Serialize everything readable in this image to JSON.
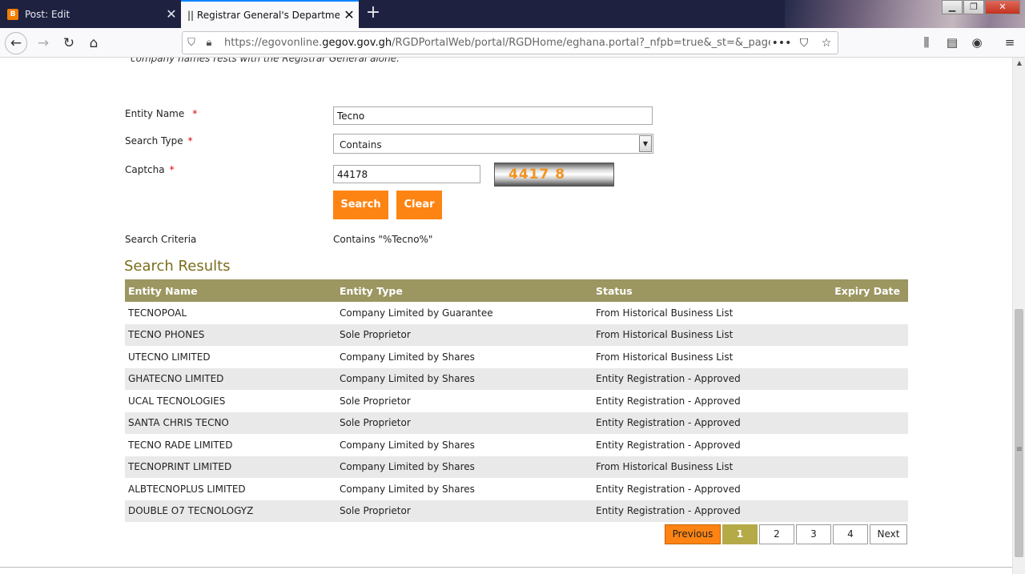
{
  "browser": {
    "tabs": [
      {
        "title": "Post: Edit",
        "favicon": "B"
      },
      {
        "title": "|| Registrar General's Department ||"
      }
    ],
    "url_prefix": "https://egovonline.",
    "url_domain": "gegov.gov.gh",
    "url_path": "/RGDPortalWeb/portal/RGDHome/eghana.portal?_nfpb=true&_st=&_pageLab"
  },
  "page": {
    "notice": "company names rests with the Registrar General alone.",
    "form": {
      "entity_name_label": "Entity Name",
      "entity_name_value": "Tecno",
      "search_type_label": "Search Type",
      "search_type_value": "Contains",
      "captcha_label": "Captcha",
      "captcha_value": "44178",
      "captcha_image_text": "4417 8",
      "required_mark": "*",
      "search_button": "Search",
      "clear_button": "Clear"
    },
    "criteria_label": "Search Criteria",
    "criteria_value": "Contains \"%Tecno%\"",
    "results_title": "Search Results",
    "results": {
      "columns": [
        "Entity Name",
        "Entity Type",
        "Status",
        "Expiry Date"
      ],
      "rows": [
        [
          "TECNOPOAL",
          "Company Limited by Guarantee",
          "From Historical Business List",
          ""
        ],
        [
          "TECNO PHONES",
          "Sole Proprietor",
          "From Historical Business List",
          ""
        ],
        [
          "UTECNO LIMITED",
          "Company Limited by Shares",
          "From Historical Business List",
          ""
        ],
        [
          "GHATECNO LIMITED",
          "Company Limited by Shares",
          "Entity Registration - Approved",
          ""
        ],
        [
          "UCAL TECNOLOGIES",
          "Sole Proprietor",
          "Entity Registration - Approved",
          ""
        ],
        [
          "SANTA CHRIS TECNO",
          "Sole Proprietor",
          "Entity Registration - Approved",
          ""
        ],
        [
          "TECNO RADE LIMITED",
          "Company Limited by Shares",
          "Entity Registration - Approved",
          ""
        ],
        [
          "TECNOPRINT LIMITED",
          "Company Limited by Shares",
          "From Historical Business List",
          ""
        ],
        [
          "ALBTECNOPLUS LIMITED",
          "Company Limited by Shares",
          "Entity Registration - Approved",
          ""
        ],
        [
          "DOUBLE O7 TECNOLOGYZ",
          "Sole Proprietor",
          "Entity Registration - Approved",
          ""
        ]
      ]
    },
    "pagination": {
      "previous": "Previous",
      "pages": [
        "1",
        "2",
        "3",
        "4"
      ],
      "current": "1",
      "next": "Next"
    }
  },
  "colors": {
    "accent_orange": "#fd8413",
    "header_olive": "#9c9661",
    "title_olive": "#7a6d1a",
    "current_page": "#b4ab48"
  }
}
